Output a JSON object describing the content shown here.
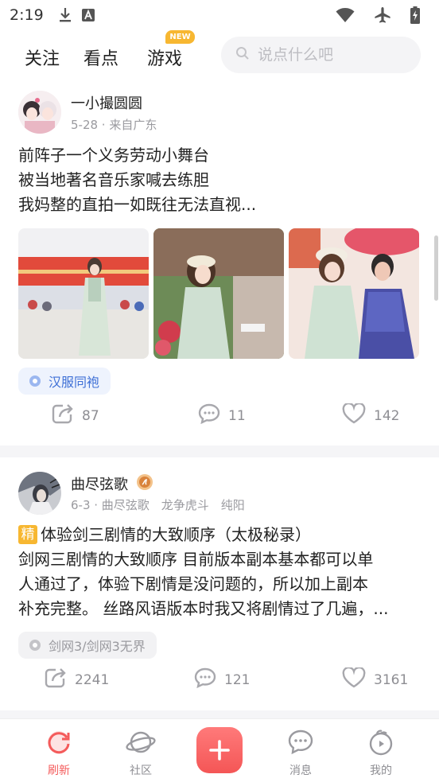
{
  "status_bar": {
    "time": "2:19",
    "icons": [
      "download-icon",
      "a-notification-icon",
      "wifi-icon",
      "airplane-icon",
      "battery-charging-icon"
    ]
  },
  "top_nav": {
    "tabs": [
      {
        "label": "关注"
      },
      {
        "label": "看点"
      },
      {
        "label": "游戏",
        "badge": "NEW"
      }
    ],
    "search": {
      "placeholder": "说点什么吧",
      "value": ""
    }
  },
  "feed": [
    {
      "author": "一小撮圆圆",
      "meta": "5-28 · 来自广东",
      "lines": [
        "前阵子一个义务劳动小舞台",
        "被当地著名音乐家喊去练胆",
        "我妈整的直拍一如既往无法直视..."
      ],
      "images": 3,
      "tag": "汉服同袍",
      "shares": "87",
      "comments": "11",
      "likes": "142"
    },
    {
      "author": "曲尽弦歌",
      "meta": "6-3 · 曲尽弦歌　龙争虎斗　纯阳",
      "featured_badge": "精",
      "title": "体验剑三剧情的大致顺序（太极秘录）",
      "lines": [
        "剑网三剧情的大致顺序 目前版本副本基本都可以单",
        "人通过了，体验下剧情是没问题的，所以加上副本",
        "补充完整。 丝路风语版本时我又将剧情过了几遍，..."
      ],
      "tag": "剑网3/剑网3无界",
      "shares": "2241",
      "comments": "121",
      "likes": "3161"
    }
  ],
  "bottom_bar": {
    "items": [
      {
        "label": "刷新",
        "icon": "refresh-icon",
        "active": true
      },
      {
        "label": "社区",
        "icon": "planet-icon"
      },
      {
        "label": "",
        "icon": "plus-icon"
      },
      {
        "label": "消息",
        "icon": "message-icon"
      },
      {
        "label": "我的",
        "icon": "profile-icon"
      }
    ]
  },
  "colors": {
    "accent": "#f45b5b",
    "badge": "#f7b731",
    "tag_bg_1": "#eef3fd",
    "tag_text_1": "#3d6fd6",
    "tag_bg_2": "#f2f2f4",
    "text_muted": "#9a9a9f"
  }
}
